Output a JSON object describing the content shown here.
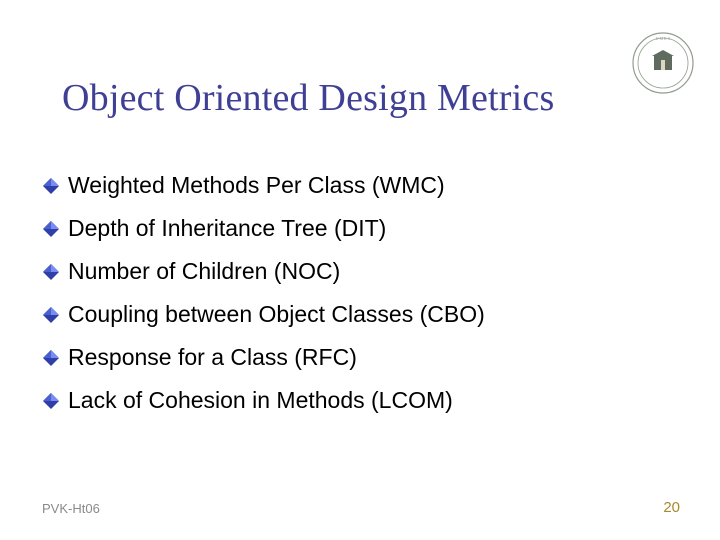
{
  "slide": {
    "title": "Object Oriented Design Metrics",
    "bullets": [
      "Weighted Methods Per Class (WMC)",
      "Depth of Inheritance Tree (DIT)",
      "Number of Children (NOC)",
      "Coupling between Object Classes (CBO)",
      "Response for a Class (RFC)",
      "Lack of Cohesion in Methods (LCOM)"
    ],
    "footer_left": "PVK-Ht06",
    "footer_right": "20"
  },
  "icons": {
    "bullet": "diamond-3d-icon",
    "logo": "umea-university-seal-icon"
  },
  "colors": {
    "title": "#3f3f95",
    "bullet_primary": "#2e3fa8",
    "bullet_highlight": "#7a8cf0",
    "footer_left": "#8a8a8a",
    "footer_right": "#a68a2e"
  }
}
